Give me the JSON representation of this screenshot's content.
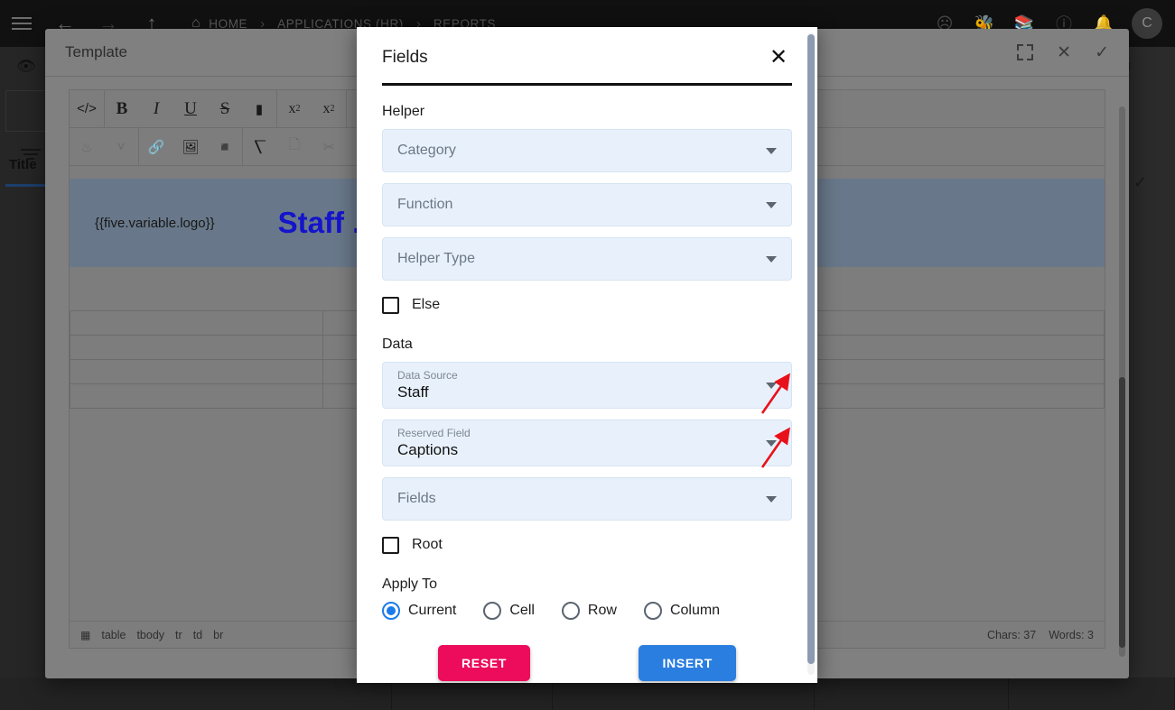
{
  "topbar": {
    "menu_icon": "hamburger-icon",
    "back_icon": "arrow-left-icon",
    "forward_icon": "arrow-right-icon",
    "up_icon": "arrow-up-icon",
    "home_icon": "home-icon",
    "breadcrumbs": [
      "HOME",
      "APPLICATIONS (HR)",
      "REPORTS"
    ],
    "separator": "›",
    "right_icons": [
      "robot-icon",
      "bug-icon",
      "books-icon",
      "help-icon",
      "bell-icon"
    ],
    "avatar_initial": "C"
  },
  "template_window": {
    "title": "Template",
    "actions": [
      "expand-icon",
      "close-icon",
      "confirm-icon"
    ],
    "toolbar_row1": [
      "</>",
      "B",
      "I",
      "U",
      "S",
      "⬬",
      "x²",
      "x₂"
    ],
    "toolbar_row2": [
      "droplet-icon",
      "chevron-down-icon",
      "link-icon",
      "image-icon",
      "video-icon",
      "format-painter-icon",
      "copy-icon",
      "cut-icon",
      "paste-icon"
    ],
    "editor": {
      "variable_token": "{{five.variable.logo}}",
      "heading": "Staff ...",
      "table_rows": 4,
      "table_cols": 2
    },
    "status": {
      "path": [
        "table",
        "tbody",
        "tr",
        "td",
        "br"
      ],
      "path_icon": "table-icon",
      "chars": "Chars: 37",
      "words": "Words: 3"
    }
  },
  "sidebar": {
    "eye_icon": "eye-icon",
    "filter_icon": "filter-icon",
    "tab_label": "Title"
  },
  "modal": {
    "title": "Fields",
    "close_icon": "close-icon",
    "sections": {
      "helper_label": "Helper",
      "data_label": "Data",
      "apply_to_label": "Apply To"
    },
    "helper_fields": [
      {
        "placeholder": "Category",
        "value": "",
        "name": "category"
      },
      {
        "placeholder": "Function",
        "value": "",
        "name": "function"
      },
      {
        "placeholder": "Helper Type",
        "value": "",
        "name": "helper-type"
      }
    ],
    "else_checkbox": {
      "label": "Else",
      "checked": false
    },
    "data_fields": [
      {
        "placeholder": "Data Source",
        "value": "Staff",
        "name": "data-source"
      },
      {
        "placeholder": "Reserved Field",
        "value": "Captions",
        "name": "reserved-field"
      },
      {
        "placeholder": "Fields",
        "value": "",
        "name": "fields"
      }
    ],
    "root_checkbox": {
      "label": "Root",
      "checked": false
    },
    "apply_to_options": [
      {
        "label": "Current",
        "selected": true
      },
      {
        "label": "Cell",
        "selected": false
      },
      {
        "label": "Row",
        "selected": false
      },
      {
        "label": "Column",
        "selected": false
      }
    ],
    "buttons": {
      "reset": "RESET",
      "insert": "INSERT"
    },
    "colors": {
      "reset_bg": "#ed0b5b",
      "insert_bg": "#2a7ee0",
      "field_bg": "#e8f1fb",
      "radio_accent": "#1c7bea",
      "annotation_arrow": "#e8111a"
    }
  }
}
